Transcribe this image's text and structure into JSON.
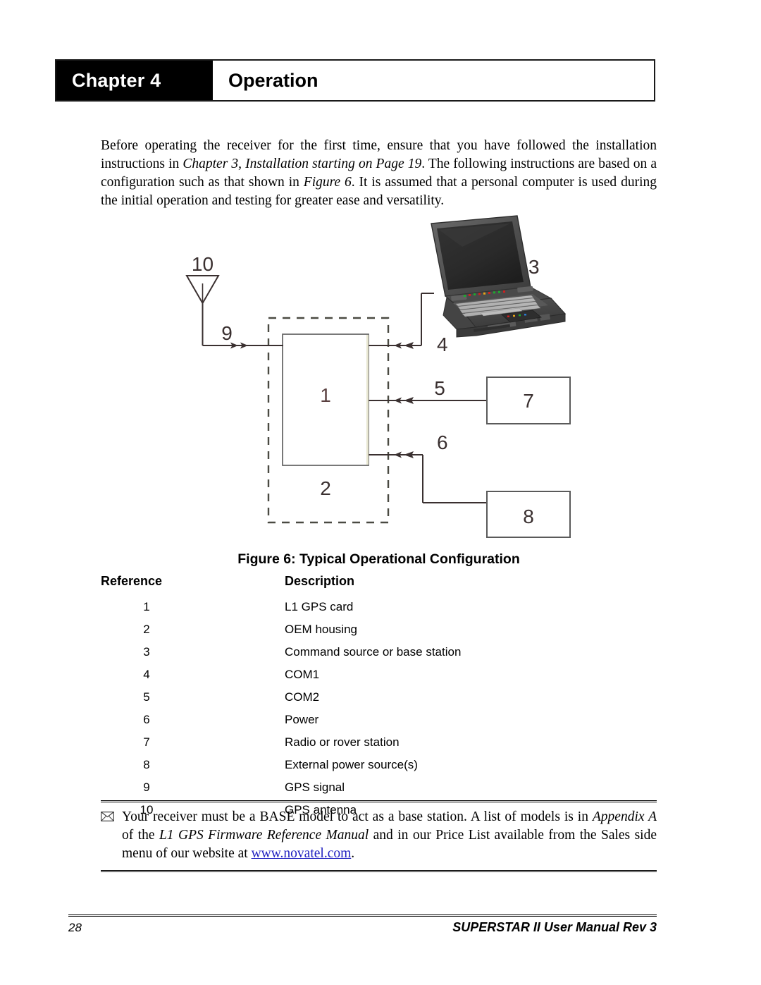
{
  "header": {
    "chapter_label": "Chapter 4",
    "title": "Operation"
  },
  "intro": {
    "part1": "Before operating the receiver for the first time, ensure that you have followed the installation instructions in ",
    "italic1": "Chapter 3, Installation starting on Page 19",
    "part2": ". The following instructions are based on a configuration such as that shown in ",
    "italic2": "Figure 6",
    "part3": ". It is assumed that a personal computer is used during the initial operation and testing for greater ease and versatility."
  },
  "figure": {
    "caption": "Figure 6: Typical Operational Configuration",
    "labels": {
      "antenna": "10",
      "gps_signal": "9",
      "gps_card": "1",
      "oem_housing": "2",
      "computer": "3",
      "com1": "4",
      "com2": "5",
      "power": "6",
      "radio_station": "7",
      "power_source": "8"
    }
  },
  "table": {
    "headers": {
      "reference": "Reference",
      "description": "Description"
    },
    "rows": [
      {
        "ref": "1",
        "desc": "L1 GPS card"
      },
      {
        "ref": "2",
        "desc": "OEM housing"
      },
      {
        "ref": "3",
        "desc": "Command source or base station"
      },
      {
        "ref": "4",
        "desc": "COM1"
      },
      {
        "ref": "5",
        "desc": "COM2"
      },
      {
        "ref": "6",
        "desc": "Power"
      },
      {
        "ref": "7",
        "desc": "Radio or rover station"
      },
      {
        "ref": "8",
        "desc": "External power source(s)"
      },
      {
        "ref": "9",
        "desc": "GPS signal"
      },
      {
        "ref": "10",
        "desc": "GPS antenna"
      }
    ]
  },
  "note": {
    "icon": "✉",
    "part1": "Your receiver must be a BASE model to act as a base station. A list of models is in ",
    "italic1": "Appendix A",
    "part2": " of the ",
    "italic2": "L1 GPS Firmware Reference Manual",
    "part3": " and in our Price List available from the Sales side menu of our website at ",
    "link": "www.novatel.com",
    "part4": "."
  },
  "footer": {
    "page_number": "28",
    "manual_title": "SUPERSTAR II User Manual Rev 3"
  },
  "colors": {
    "tab_background": "#000000",
    "tab_text": "#ffffff",
    "line": "#3a3030",
    "dashed": "#4a4a42",
    "link": "#2020c0",
    "laptop_body": "#4a4a4a",
    "laptop_screen": "#2b2b2b",
    "card_edge": "#e9e8d2"
  }
}
